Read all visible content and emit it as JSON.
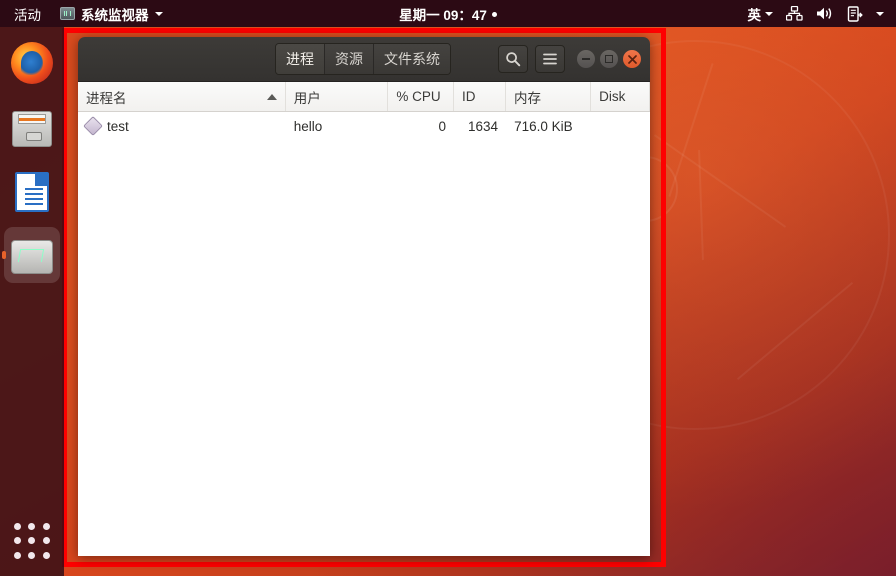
{
  "topbar": {
    "activities": "活动",
    "app_name": "系统监视器",
    "app_icon": "system-monitor-icon",
    "clock": "星期一 09：47",
    "language": "英",
    "icons": [
      "network-icon",
      "volume-icon",
      "power-icon",
      "chevron-down-icon"
    ]
  },
  "dock": {
    "items": [
      {
        "name": "firefox",
        "label": "Firefox",
        "active": false
      },
      {
        "name": "files",
        "label": "文件",
        "active": false
      },
      {
        "name": "libreoffice",
        "label": "LibreOffice",
        "active": false
      },
      {
        "name": "system-monitor",
        "label": "系统监视器",
        "active": true
      }
    ],
    "show_apps_label": "显示应用程序"
  },
  "window": {
    "title": "系统监视器",
    "tabs": [
      {
        "label": "进程",
        "active": true
      },
      {
        "label": "资源",
        "active": false
      },
      {
        "label": "文件系统",
        "active": false
      }
    ],
    "buttons": {
      "search": "搜索",
      "menu": "菜单",
      "minimize": "最小化",
      "maximize": "最大化",
      "close": "关闭"
    }
  },
  "table": {
    "columns": [
      {
        "label": "进程名",
        "align": "left",
        "sorted": "asc"
      },
      {
        "label": "用户",
        "align": "left",
        "sorted": ""
      },
      {
        "label": "% CPU",
        "align": "left",
        "sorted": ""
      },
      {
        "label": "ID",
        "align": "left",
        "sorted": ""
      },
      {
        "label": "内存",
        "align": "left",
        "sorted": ""
      },
      {
        "label": "Disk",
        "align": "left",
        "sorted": ""
      }
    ],
    "rows": [
      {
        "process_name": "test",
        "user": "hello",
        "cpu": "0",
        "id": "1634",
        "memory": "716.0 KiB",
        "disk": ""
      }
    ]
  },
  "colors": {
    "highlight_frame": "#ff0000",
    "panel": "#2c0a14",
    "desktop": "#d9471d",
    "accent": "#e8622a"
  }
}
